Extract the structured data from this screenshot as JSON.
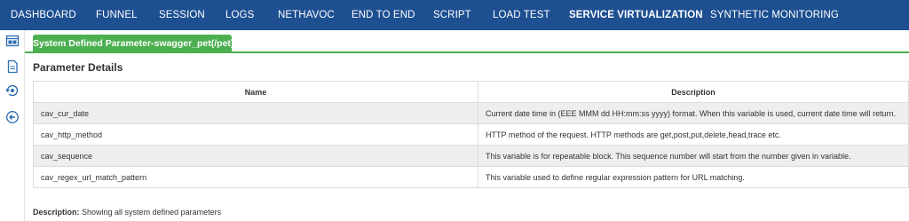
{
  "nav": {
    "items": [
      {
        "label": "DASHBOARD",
        "active": false
      },
      {
        "label": "FUNNEL",
        "active": false
      },
      {
        "label": "SESSION",
        "active": false
      },
      {
        "label": "LOGS",
        "active": false
      },
      {
        "label": "NETHAVOC",
        "active": false
      },
      {
        "label": "END TO END",
        "active": false
      },
      {
        "label": "SCRIPT",
        "active": false
      },
      {
        "label": "LOAD TEST",
        "active": false
      },
      {
        "label": "SERVICE VIRTUALIZATION",
        "active": true
      },
      {
        "label": "SYNTHETIC MONITORING",
        "active": false
      }
    ]
  },
  "sidebar": {
    "icons": [
      "layout-icon",
      "document-icon",
      "refresh-eye-icon",
      "back-arrow-icon"
    ]
  },
  "tab": {
    "label": "System Defined Parameter-swagger_pet(/pet)"
  },
  "section": {
    "title": "Parameter Details"
  },
  "table": {
    "headers": [
      "Name",
      "Description"
    ],
    "rows": [
      {
        "name": "cav_cur_date",
        "description": "Current date time in (EEE MMM dd HH:mm:ss yyyy) format. When this variable is used, current date time will return."
      },
      {
        "name": "cav_http_method",
        "description": "HTTP method of the request. HTTP methods are get,post,put,delete,head,trace etc."
      },
      {
        "name": "cav_sequence",
        "description": "This variable is for repeatable block. This sequence number will start from the number given in variable."
      },
      {
        "name": "cav_regex_url_match_pattern",
        "description": "This variable used to define regular expression pattern for URL matching."
      }
    ]
  },
  "footer": {
    "label": "Description:",
    "text": "Showing all system defined parameters"
  },
  "colors": {
    "nav_bg": "#1d4f91",
    "tab_green": "#4caf50",
    "row_shade": "#eeeeee",
    "icon_blue": "#2b6cb0"
  }
}
